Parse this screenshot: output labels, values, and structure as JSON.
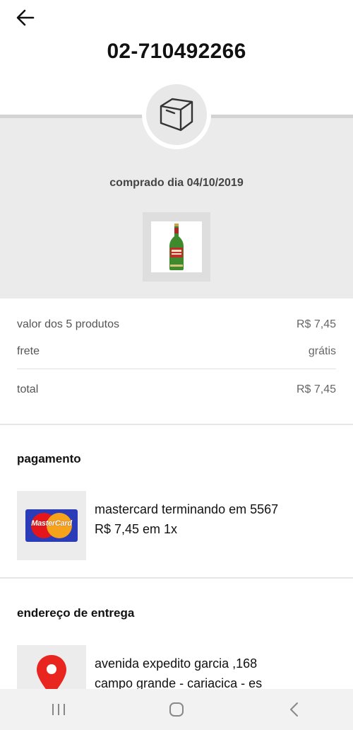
{
  "header": {
    "back_icon": "arrow-left-icon",
    "order_number": "02-710492266"
  },
  "order": {
    "box_icon": "package-box-icon",
    "purchase_date": "comprado dia 04/10/2019",
    "product_image": "beer-bottle"
  },
  "summary": {
    "products_label": "valor dos 5 produtos",
    "products_value": "R$ 7,45",
    "shipping_label": "frete",
    "shipping_value": "grátis",
    "total_label": "total",
    "total_value": "R$ 7,45"
  },
  "payment": {
    "title": "pagamento",
    "card_brand_logo": "MasterCard",
    "card_line": "mastercard terminando em 5567",
    "installments_line": "R$ 7,45 em 1x"
  },
  "delivery": {
    "title": "endereço de entrega",
    "icon": "location-pin-icon",
    "street_line": "avenida expedito garcia ,168",
    "city_line": "campo grande - cariacica - es"
  },
  "system_nav": {
    "recents_icon": "recents-icon",
    "home_icon": "home-icon",
    "back_icon": "chevron-left-icon"
  },
  "colors": {
    "band_gray": "#ebebeb",
    "pin_red": "#e8261f",
    "mastercard_blue": "#2a3cb7",
    "mastercard_red": "#e4161b",
    "mastercard_yellow": "#f7a21b"
  }
}
